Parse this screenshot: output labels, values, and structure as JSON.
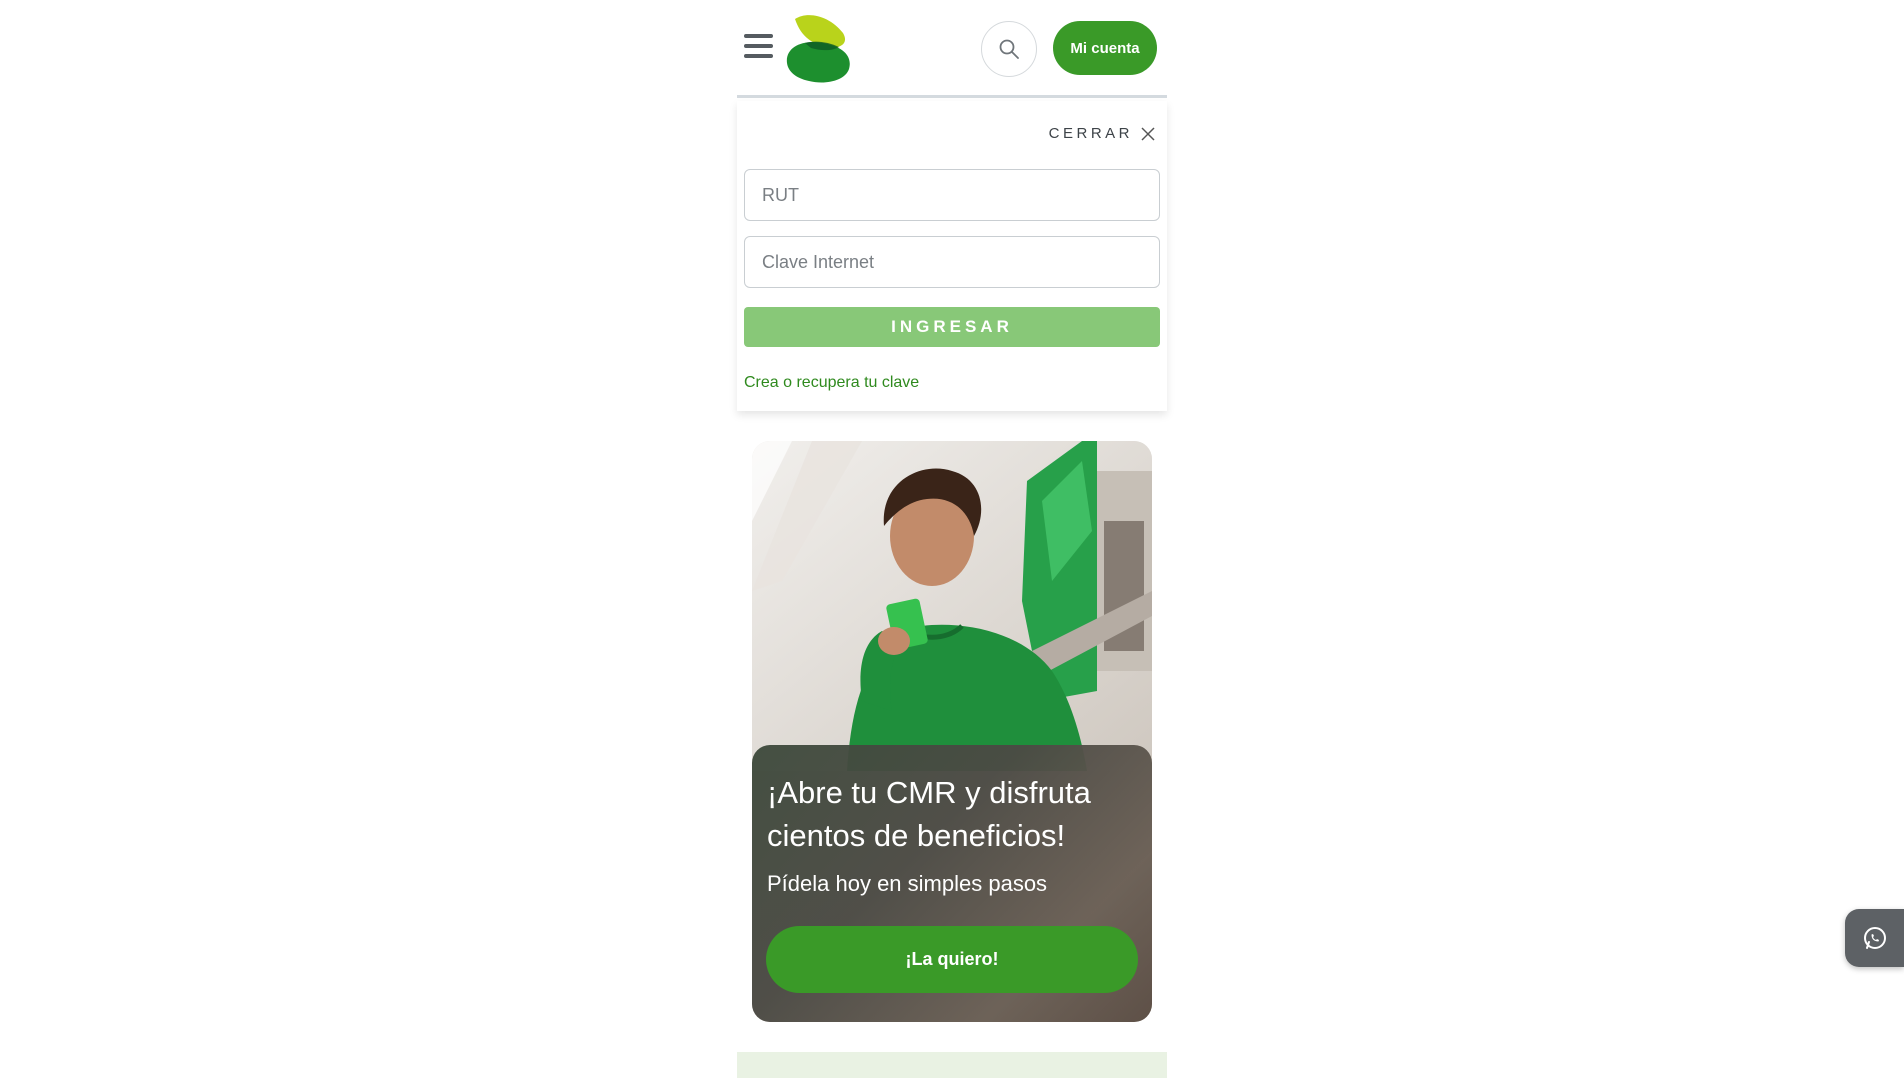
{
  "header": {
    "menu_icon": "hamburger-menu-icon",
    "logo_icon": "bank-logo-icon",
    "search_icon": "search-icon",
    "account_label": "Mi cuenta",
    "brand_color": "#3a9a28"
  },
  "login": {
    "close_label": "CERRAR",
    "close_icon": "close-icon",
    "rut_placeholder": "RUT",
    "password_placeholder": "Clave Internet",
    "submit_label": "INGRESAR",
    "recover_link": "Crea o recupera tu clave",
    "submit_color": "#88c878"
  },
  "promo": {
    "title": "¡Abre tu CMR y disfruta cientos de beneficios!",
    "subtitle": "Pídela hoy en simples pasos",
    "cta_label": "¡La quiero!"
  },
  "floating": {
    "whatsapp_icon": "whatsapp-icon"
  }
}
